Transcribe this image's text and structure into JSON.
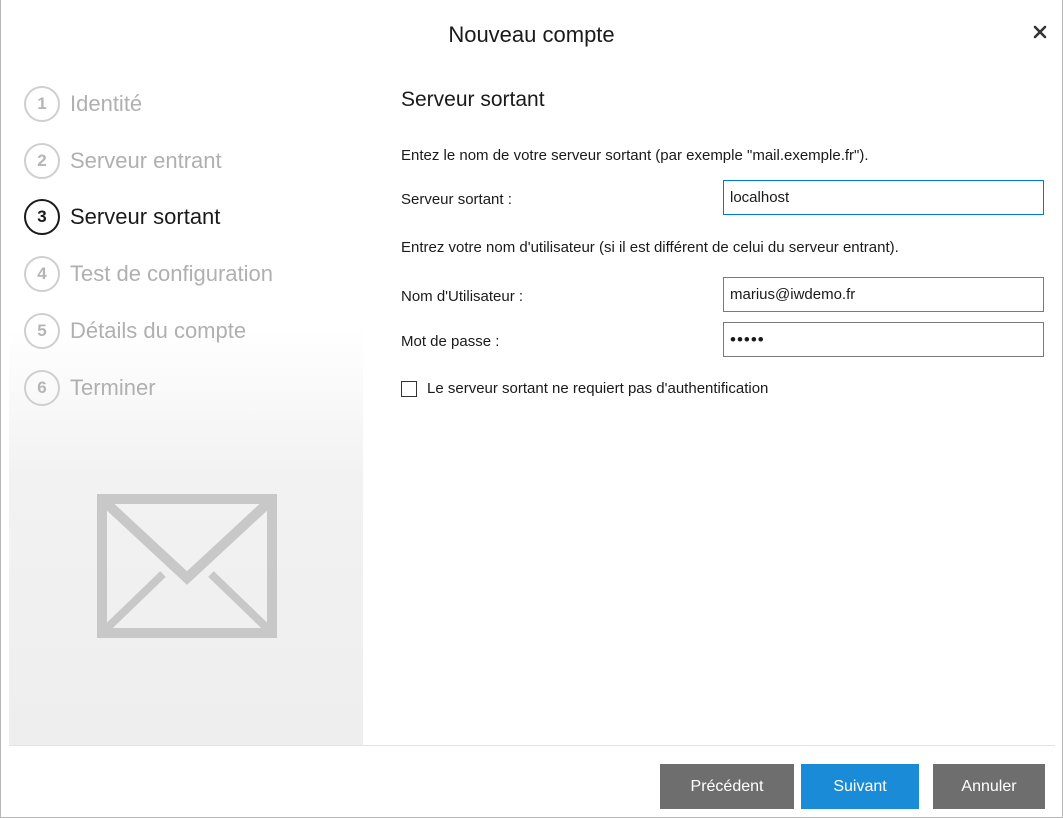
{
  "window": {
    "title": "Nouveau compte"
  },
  "steps": [
    {
      "number": "1",
      "label": "Identité",
      "active": false
    },
    {
      "number": "2",
      "label": "Serveur entrant",
      "active": false
    },
    {
      "number": "3",
      "label": "Serveur sortant",
      "active": true
    },
    {
      "number": "4",
      "label": "Test de configuration",
      "active": false
    },
    {
      "number": "5",
      "label": "Détails du compte",
      "active": false
    },
    {
      "number": "6",
      "label": "Terminer",
      "active": false
    }
  ],
  "content": {
    "title": "Serveur sortant",
    "instruction_server": "Entez le nom de votre serveur sortant (par exemple \"mail.exemple.fr\").",
    "server_label": "Serveur sortant :",
    "server_value": "localhost",
    "instruction_user": "Entrez votre nom d'utilisateur (si il est différent de celui du serveur entrant).",
    "username_label": "Nom d'Utilisateur :",
    "username_value": "marius@iwdemo.fr",
    "password_label": "Mot de passe :",
    "password_value": "•••••",
    "no_auth_label": "Le serveur sortant ne requiert pas d'authentification",
    "no_auth_checked": false
  },
  "footer": {
    "previous_label": "Précédent",
    "next_label": "Suivant",
    "cancel_label": "Annuler"
  },
  "colors": {
    "accent": "#1a8bd6",
    "button_gray": "#6e6e6e",
    "step_inactive": "#b0b0b0",
    "step_active": "#1a1a1a",
    "envelope": "#c8c8c8"
  },
  "icons": {
    "close": "close-icon",
    "sidebar_illustration": "envelope-icon"
  }
}
